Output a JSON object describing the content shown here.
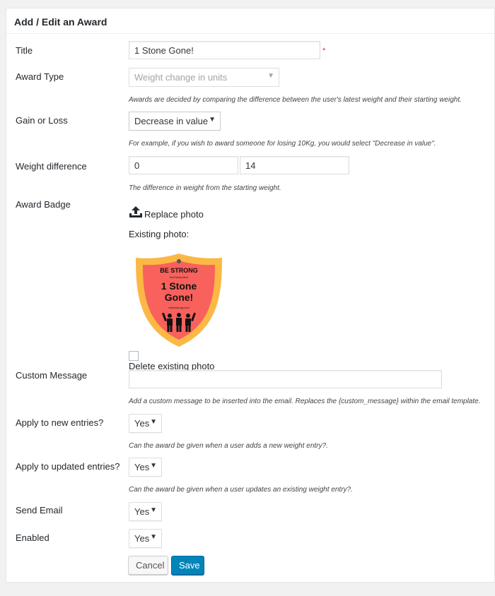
{
  "panel": {
    "title": "Add / Edit an Award"
  },
  "fields": {
    "title": {
      "label": "Title",
      "value": "1 Stone Gone!",
      "required_mark": "*"
    },
    "award_type": {
      "label": "Award Type",
      "value": "Weight change in units",
      "help": "Awards are decided by comparing the difference between the user's latest weight and their starting weight."
    },
    "gain_or_loss": {
      "label": "Gain or Loss",
      "value": "Decrease in value",
      "help": "For example, if you wish to award someone for losing 10Kg, you would select \"Decrease in value\"."
    },
    "weight_difference": {
      "label": "Weight difference",
      "value_1": "0",
      "value_2": "14",
      "help": "The difference in weight from the starting weight."
    },
    "award_badge": {
      "label": "Award Badge",
      "replace_label": "Replace photo",
      "existing_label": "Existing photo:",
      "delete_label": "Delete existing photo",
      "badge": {
        "line1": "BE STRONG",
        "line2": "Self Motivation",
        "line3": "1 Stone",
        "line4": "Gone!",
        "line5": "mybestrong.com"
      }
    },
    "custom_message": {
      "label": "Custom Message",
      "value": "",
      "help": "Add a custom message to be inserted into the email. Replaces the {custom_message} within the email template."
    },
    "apply_new": {
      "label": "Apply to new entries?",
      "value": "Yes",
      "help": "Can the award be given when a user adds a new weight entry?."
    },
    "apply_updated": {
      "label": "Apply to updated entries?",
      "value": "Yes",
      "help": "Can the award be given when a user updates an existing weight entry?."
    },
    "send_email": {
      "label": "Send Email",
      "value": "Yes"
    },
    "enabled": {
      "label": "Enabled",
      "value": "Yes"
    }
  },
  "buttons": {
    "cancel": "Cancel",
    "save": "Save"
  },
  "icons": {
    "select_arrow": "▼",
    "upload": "upload-icon"
  },
  "colors": {
    "primary": "#0085ba",
    "badge_fill": "#f8615c",
    "badge_rim": "#fbb845",
    "required": "#dc3232"
  }
}
